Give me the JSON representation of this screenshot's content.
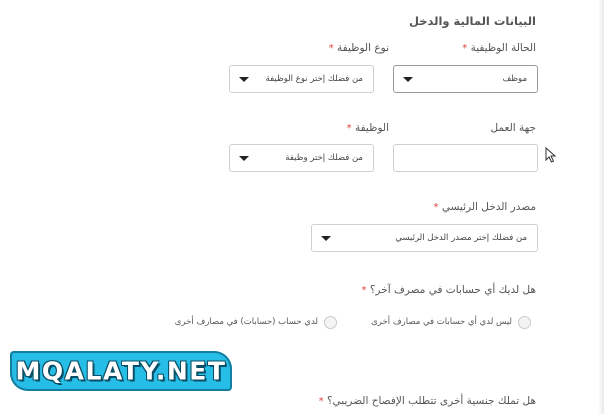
{
  "section": {
    "title": "البيانات المالية والدخل"
  },
  "fields": {
    "employment_status": {
      "label": "الحالة الوظيفية",
      "required_mark": "*",
      "value": "موظف"
    },
    "job_type": {
      "label": "نوع الوظيفة",
      "required_mark": "*",
      "value": "من فضلك إختر نوع الوظيفة"
    },
    "employer": {
      "label": "جهة العمل",
      "required_mark": "*",
      "value": ""
    },
    "job": {
      "label": "الوظيفة",
      "required_mark": "*",
      "value": "من فضلك إختر وظيفة"
    },
    "main_income_source": {
      "label": "مصدر الدخل الرئيسي",
      "required_mark": "*",
      "value": "من فضلك إختر مصدر الدخل الرئيسي"
    },
    "other_bank_accounts": {
      "question": "هل لديك أي حسابات في مصرف آخر؟",
      "required_mark": "*",
      "options": [
        "ليس لدي أي حسابات في مصارف أخرى",
        "لدي حساب (حسابات) في مصارف أخرى"
      ]
    },
    "other_nationality": {
      "question": "هل تملك جنسية أخرى تتطلب الإفصاح الضريبي؟",
      "required_mark": "*"
    }
  },
  "watermark": {
    "text": "MQALATY.NET"
  },
  "colors": {
    "required": "#d9433a",
    "banner": "#26bde6"
  }
}
